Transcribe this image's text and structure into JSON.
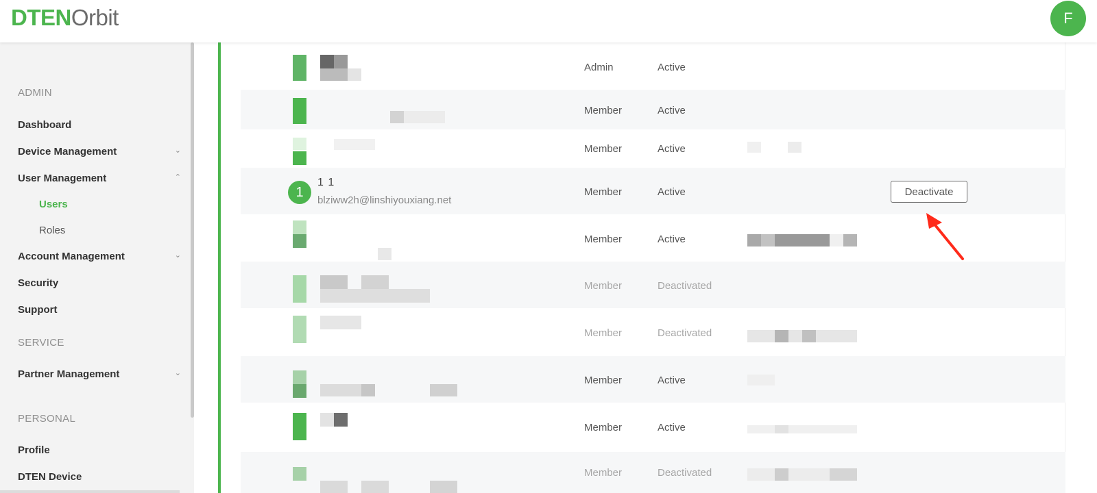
{
  "brand": {
    "part1": "DTEN",
    "part2": "Orbit",
    "color": "#4cb54e"
  },
  "user_avatar": "F",
  "sidebar": {
    "admin_header": "ADMIN",
    "dashboard": "Dashboard",
    "device_management": "Device Management",
    "user_management": "User Management",
    "users": "Users",
    "roles": "Roles",
    "account_management": "Account Management",
    "security": "Security",
    "support": "Support",
    "service_header": "SERVICE",
    "partner_management": "Partner Management",
    "personal_header": "PERSONAL",
    "profile": "Profile",
    "dten_device": "DTEN Device"
  },
  "rows": [
    {
      "role": "Admin",
      "status": "Active"
    },
    {
      "role": "Member",
      "status": "Active"
    },
    {
      "role": "Member",
      "status": "Active"
    },
    {
      "role": "Member",
      "status": "Active",
      "name": "1 1",
      "email": "blziww2h@linshiyouxiang.net",
      "badge": "1",
      "action": "Deactivate"
    },
    {
      "role": "Member",
      "status": "Active"
    },
    {
      "role": "Member",
      "status": "Deactivated"
    },
    {
      "role": "Member",
      "status": "Deactivated"
    },
    {
      "role": "Member",
      "status": "Active"
    },
    {
      "role": "Member",
      "status": "Active"
    },
    {
      "role": "Member",
      "status": "Deactivated"
    }
  ],
  "icons": {
    "chevron_down": "chevron-down-icon",
    "chevron_up": "chevron-up-icon",
    "arrow": "red-arrow-annotation"
  },
  "colors": {
    "accent": "#4cb54e",
    "annotation": "#ff2a1a"
  }
}
